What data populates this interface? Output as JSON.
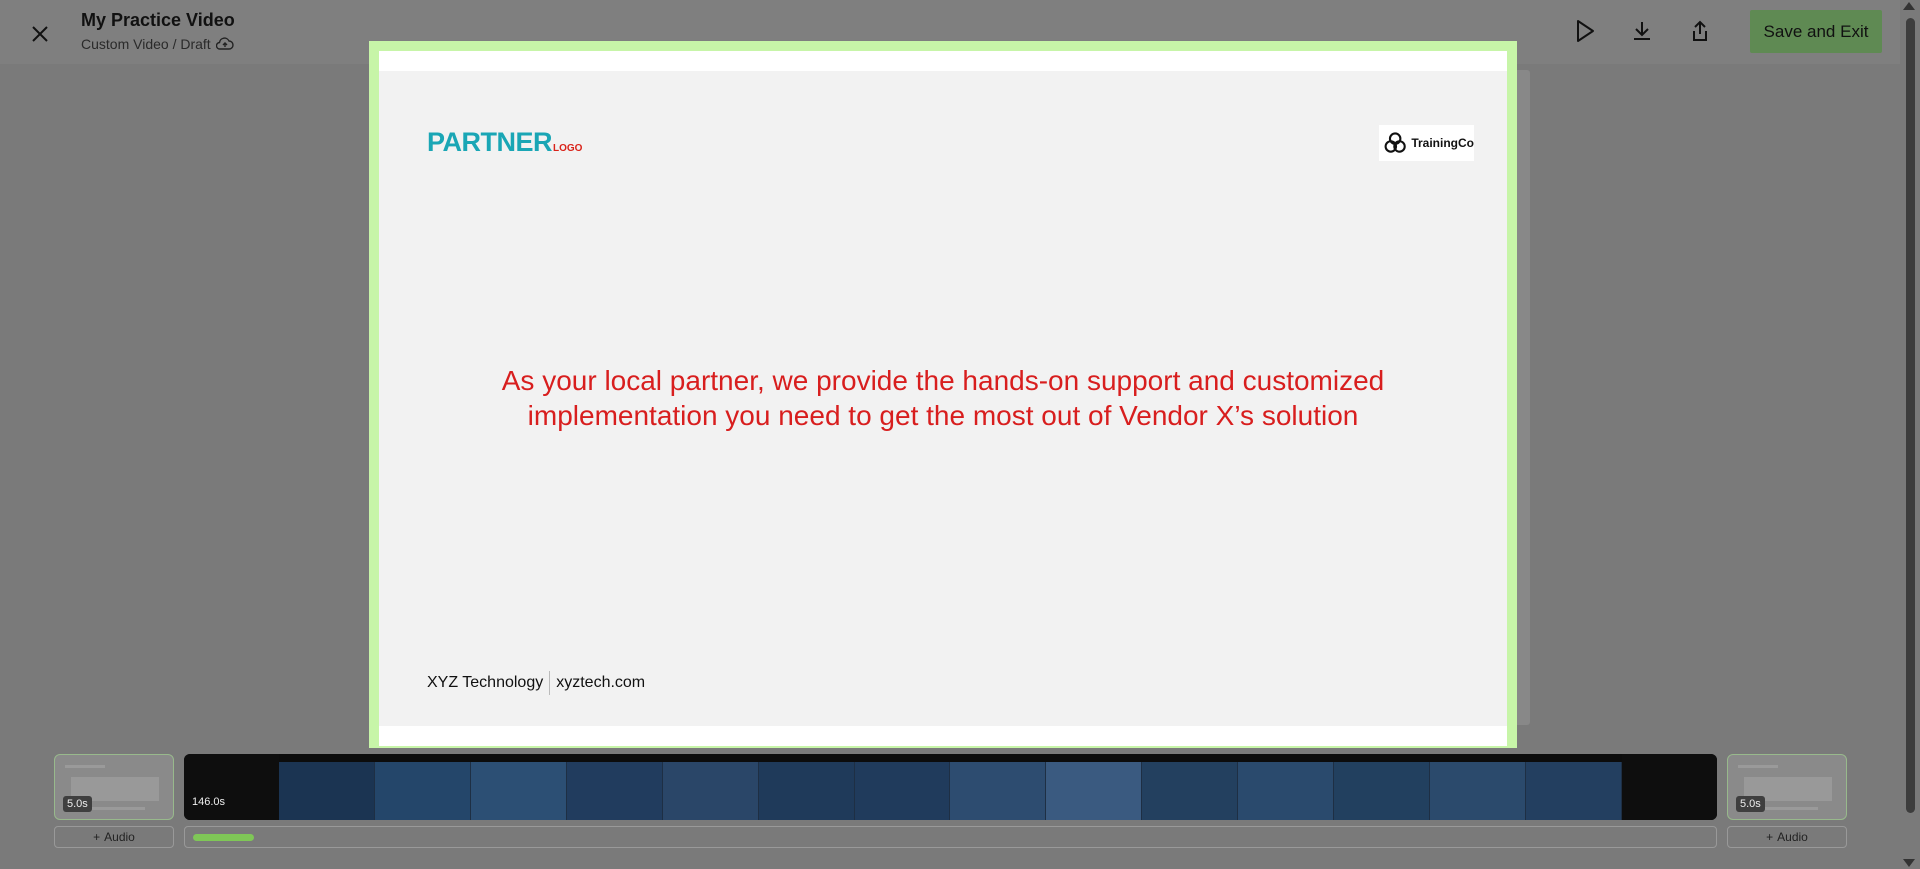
{
  "header": {
    "title": "My Practice Video",
    "subtitle": "Custom Video / Draft",
    "save_label": "Save and Exit",
    "icons": [
      "close-icon",
      "cloud-upload-icon",
      "play-icon",
      "download-icon",
      "share-icon"
    ]
  },
  "slide": {
    "partner_logo_main": "PARTNER",
    "partner_logo_sub": "LOGO",
    "company_logo": "TrainingCo",
    "message": "As your local partner, we provide the hands-on support and customized implementation you need to get the most out of Vendor X’s solution",
    "footer_company": "XYZ Technology",
    "footer_url": "xyztech.com"
  },
  "timeline": {
    "intro_duration": "5.0s",
    "main_duration": "146.0s",
    "outro_duration": "5.0s",
    "audio_label_left": "Audio",
    "audio_label_right": "Audio",
    "progress_fraction": 0.04,
    "thumbnail_count": 14
  },
  "colors": {
    "preview_border": "#c7f5a8",
    "save_button": "#5f8a53",
    "partner_teal": "#1aa6b5",
    "message_red": "#d81e1e",
    "progress_green": "#7fc757"
  }
}
